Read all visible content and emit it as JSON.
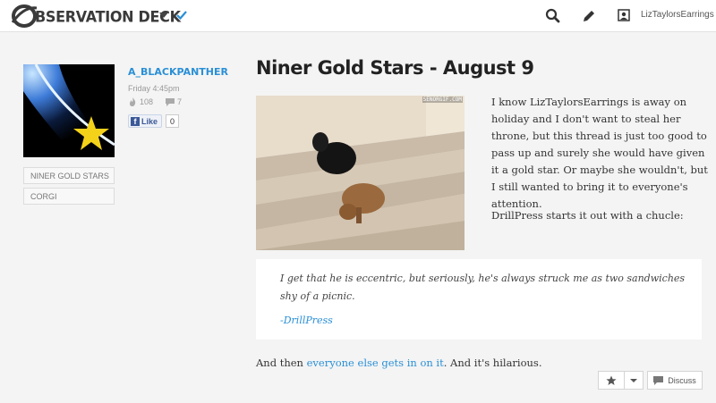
{
  "header": {
    "logo_text": "BSERVATION DECK",
    "username": "LizTaylorsEarrings"
  },
  "sidebar": {
    "tags": [
      "NINER GOLD STARS",
      "CORGI"
    ]
  },
  "byline": {
    "author": "A_BLACKPANTHER",
    "time": "Friday 4:45pm",
    "views": "108",
    "comments": "7",
    "like_label": "Like",
    "like_count": "0"
  },
  "article": {
    "title": "Niner Gold Stars - August 9",
    "gif_watermark": "SENORGIF.COM",
    "paragraph1": "I know LizTaylorsEarrings is away on holiday and I don't want to steal her throne, but this thread is just too good to pass up and surely she would have given it a gold star. Or maybe she wouldn't, but I still wanted to bring it to everyone's attention.",
    "paragraph2": "DrillPress starts it out with a chucle:",
    "quote": "I get that he is eccentric, but seriously, he's always struck me as two sandwiches shy of a picnic.",
    "quote_cite": "-DrillPress",
    "paragraph3_before": "And then ",
    "paragraph3_link": "everyone else gets in on it",
    "paragraph3_after": ". And it's hilarious."
  },
  "actions": {
    "discuss_label": "Discuss"
  },
  "colors": {
    "accent": "#2a8fd6",
    "background": "#f4f4f4"
  },
  "icons": [
    "observation-deck-logo-icon",
    "chevron-down-icon",
    "checkmark-icon",
    "search-icon",
    "pencil-icon",
    "user-icon",
    "flame-icon",
    "comment-icon",
    "facebook-icon",
    "star-icon",
    "discuss-icon"
  ]
}
